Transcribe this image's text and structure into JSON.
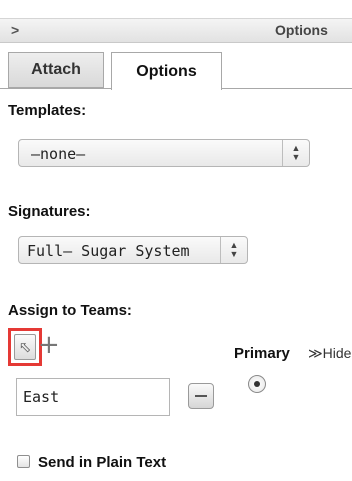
{
  "header": {
    "collapse_icon": "chevron-right",
    "title": "Options"
  },
  "tabs": [
    {
      "label": "Attach",
      "active": false
    },
    {
      "label": "Options",
      "active": true
    }
  ],
  "templates": {
    "label": "Templates:",
    "value": "–none–"
  },
  "signatures": {
    "label": "Signatures:",
    "value": "Full– Sugar System"
  },
  "teams": {
    "label": "Assign to Teams:",
    "select_icon": "cursor-arrow",
    "add_icon": "plus",
    "primary_label": "Primary",
    "hide_label": "≫Hide",
    "rows": [
      {
        "name": "East",
        "primary": true
      }
    ],
    "highlight_color": "#e53935"
  },
  "plain_text": {
    "label": "Send in Plain Text",
    "checked": false
  }
}
